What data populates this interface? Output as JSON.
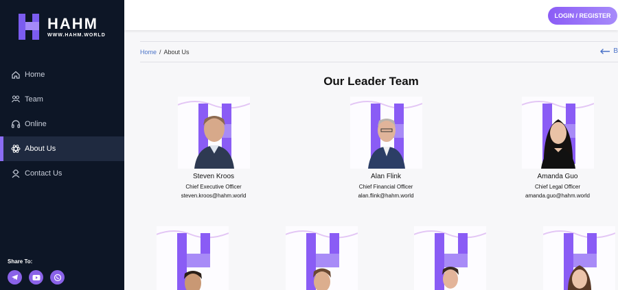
{
  "brand": {
    "name": "HAHM",
    "domain": "WWW.HAHM.WORLD",
    "accent": "#8b6df4"
  },
  "nav": {
    "items": [
      {
        "label": "Home",
        "icon": "home-icon"
      },
      {
        "label": "Team",
        "icon": "team-icon"
      },
      {
        "label": "Online",
        "icon": "headset-icon"
      },
      {
        "label": "About Us",
        "icon": "atom-icon",
        "active": true
      },
      {
        "label": "Contact Us",
        "icon": "contact-icon"
      }
    ]
  },
  "share": {
    "label": "Share To:",
    "icons": [
      "telegram-icon",
      "youtube-icon",
      "whatsapp-icon"
    ]
  },
  "header": {
    "login_label": "LOGIN / REGISTER"
  },
  "breadcrumb": {
    "home": "Home",
    "separator": "/",
    "current": "About Us",
    "back": "B"
  },
  "section": {
    "title": "Our Leader Team"
  },
  "team": [
    {
      "name": "Steven Kroos",
      "role": "Chief Executive Officer",
      "email": "steven.kroos@hahm.world"
    },
    {
      "name": "Alan Flink",
      "role": "Chief Financial Officer",
      "email": "alan.flink@hahm.world"
    },
    {
      "name": "Amanda Guo",
      "role": "Chief Legal Officer",
      "email": "amanda.guo@hahm.world"
    }
  ]
}
